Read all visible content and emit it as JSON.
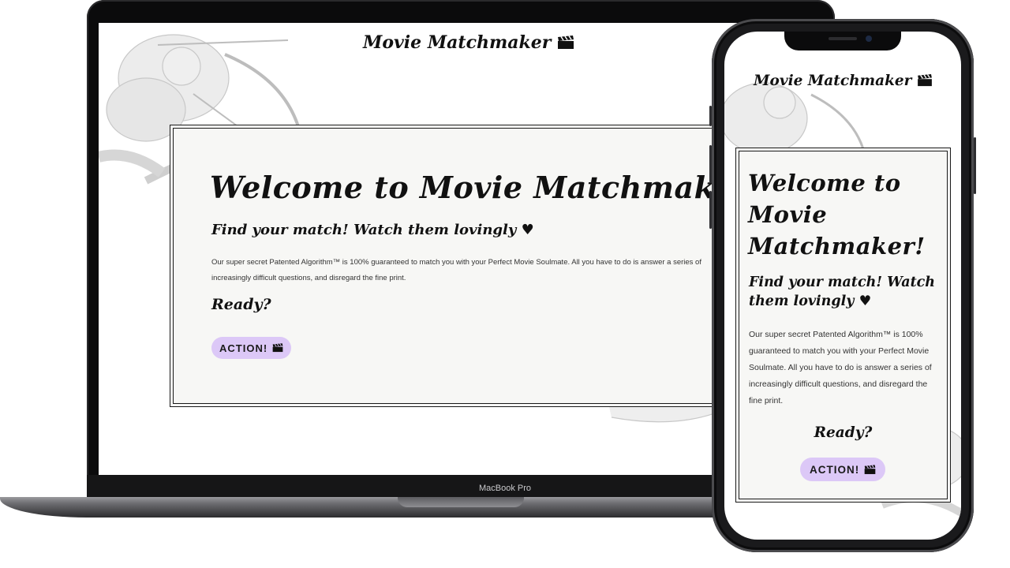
{
  "laptop": {
    "site_title": "Movie Matchmaker",
    "heading": "Welcome to Movie Matchmaker!",
    "subheading": "Find your match! Watch them lovingly",
    "description": "Our super secret Patented Algorithm™ is 100% guaranteed to match you with your Perfect Movie Soulmate. All you have to do is answer a series of increasingly difficult questions, and disregard the fine print.",
    "ready": "Ready?",
    "action_button": "ACTION!",
    "device_label": "MacBook Pro"
  },
  "phone": {
    "site_title": "Movie Matchmaker",
    "heading": "Welcome to Movie Matchmaker!",
    "subheading": "Find your match! Watch them lovingly",
    "description": "Our super secret Patented Algorithm™ is 100% guaranteed to match you with your Perfect Movie Soulmate. All you have to do is answer a series of increasingly difficult questions, and disregard the fine print.",
    "ready": "Ready?",
    "action_button": "ACTION!"
  },
  "icons": {
    "clapperboard": "clapperboard-icon",
    "heart": "heart-icon"
  },
  "colors": {
    "button_bg": "#dcc8f7",
    "card_bg": "#f7f7f5",
    "text": "#111111"
  }
}
